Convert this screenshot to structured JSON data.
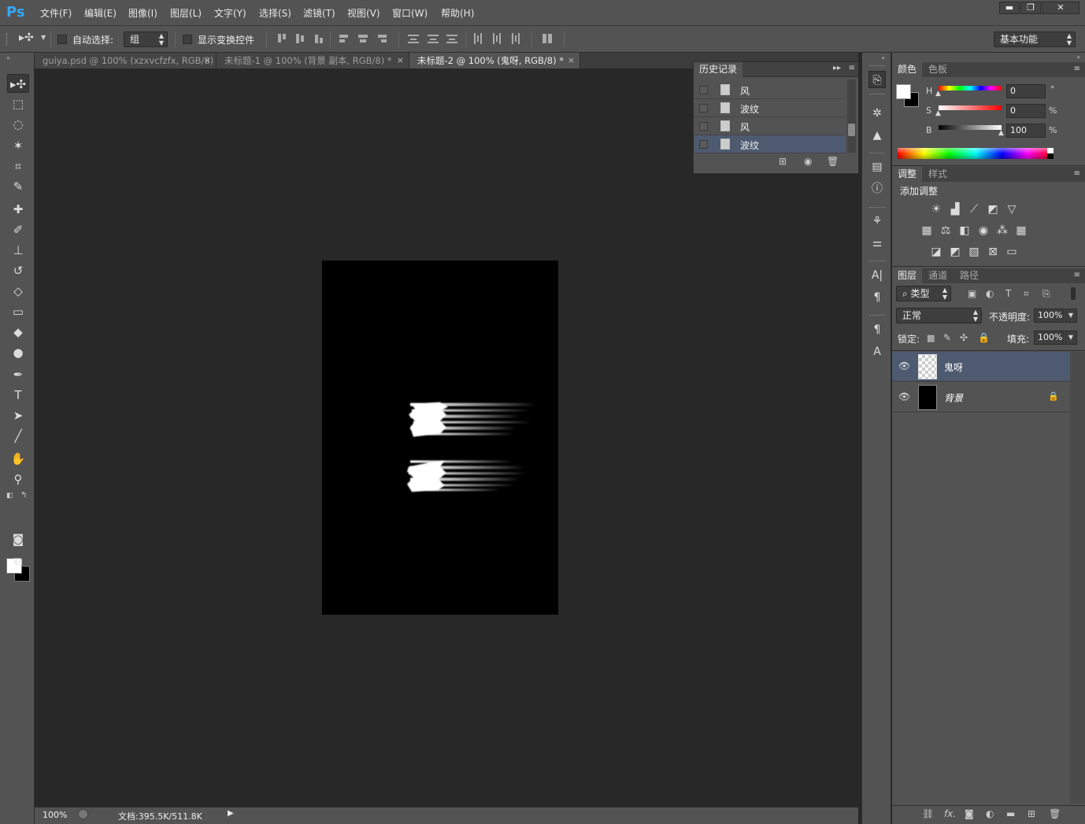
{
  "app": {
    "logo": "Ps",
    "menu": [
      "文件(F)",
      "编辑(E)",
      "图像(I)",
      "图层(L)",
      "文字(Y)",
      "选择(S)",
      "滤镜(T)",
      "视图(V)",
      "窗口(W)",
      "帮助(H)"
    ],
    "window_controls": [
      "▬",
      "❐",
      "✕"
    ]
  },
  "options": {
    "auto_select_label": "自动选择:",
    "auto_select_value": "组",
    "show_transform_label": "显示变换控件",
    "workspace": "基本功能"
  },
  "tabs": [
    {
      "label": "guiya.psd @ 100% (xzxvcfzfx, RGB/8)",
      "close": "×"
    },
    {
      "label": "未标题-1 @ 100% (背景 副本, RGB/8) *",
      "close": "×"
    },
    {
      "label": "未标题-2 @ 100% (鬼呀, RGB/8) *",
      "close": "×"
    }
  ],
  "status": {
    "zoom": "100%",
    "doc_info": "文档:395.5K/511.8K"
  },
  "history": {
    "title": "历史记录",
    "items": [
      "风",
      "波纹",
      "风",
      "波纹"
    ],
    "selected_index": 3
  },
  "color_panel": {
    "tabs": [
      "颜色",
      "色板"
    ],
    "h_label": "H",
    "h_value": "0",
    "h_unit": "°",
    "s_label": "S",
    "s_value": "0",
    "s_unit": "%",
    "b_label": "B",
    "b_value": "100",
    "b_unit": "%"
  },
  "adjustments": {
    "tabs": [
      "调整",
      "样式"
    ],
    "title": "添加调整"
  },
  "layers": {
    "tabs": [
      "图层",
      "通道",
      "路径"
    ],
    "filter_label": "类型",
    "blend_mode": "正常",
    "opacity_label": "不透明度:",
    "opacity_value": "100%",
    "lock_label": "锁定:",
    "fill_label": "填充:",
    "fill_value": "100%",
    "items": [
      {
        "name": "鬼呀",
        "selected": true
      },
      {
        "name": "背景",
        "locked": true
      }
    ]
  },
  "colors": {
    "accent": "#31a8ff",
    "selection": "#4d5a6f",
    "panel": "#535353",
    "canvas": "#282828"
  }
}
